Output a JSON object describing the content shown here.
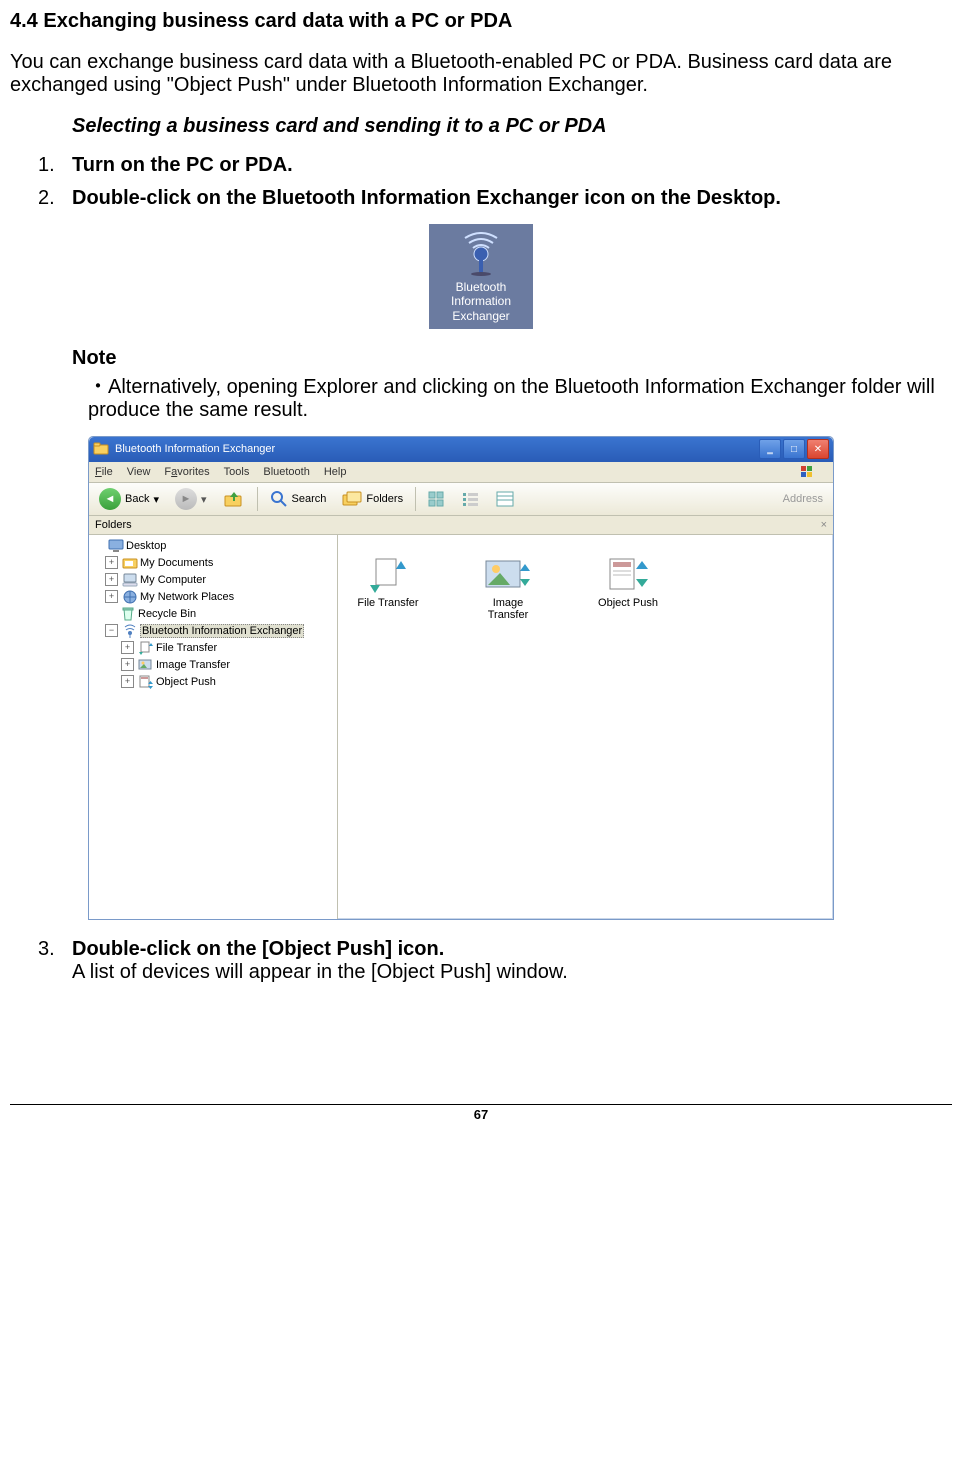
{
  "section_title": "4.4  Exchanging business card data with a PC or PDA",
  "intro": "You can exchange business card data with a Bluetooth-enabled PC or PDA. Business card data are exchanged using \"Object Push\" under Bluetooth Information Exchanger.",
  "sub_heading": "Selecting a business card and sending it to a PC or PDA",
  "steps": {
    "s1": {
      "num": "1.",
      "text": "Turn on the PC or PDA."
    },
    "s2": {
      "num": "2.",
      "text": "Double-click on the Bluetooth Information Exchanger icon on the Desktop."
    },
    "s3": {
      "num": "3.",
      "bold": "Double-click on the [Object Push] icon.",
      "plain": "A list of devices will appear in the [Object Push] window."
    }
  },
  "desktop_icon": {
    "line1": "Bluetooth",
    "line2": "Information",
    "line3": "Exchanger"
  },
  "note": {
    "head": "Note",
    "body": "・Alternatively, opening Explorer and clicking on the Bluetooth Information Exchanger folder will produce the same result."
  },
  "explorer": {
    "title": "Bluetooth Information Exchanger",
    "menu": {
      "file": "File",
      "view": "View",
      "fav": "Favorites",
      "tools": "Tools",
      "bt": "Bluetooth",
      "help": "Help"
    },
    "toolbar": {
      "back": "Back",
      "search": "Search",
      "folders": "Folders",
      "address": "Address"
    },
    "folders_label": "Folders",
    "tree": {
      "desktop": "Desktop",
      "mydocs": "My Documents",
      "mycomp": "My Computer",
      "mynet": "My Network Places",
      "recycle": "Recycle Bin",
      "bie": "Bluetooth Information Exchanger",
      "ft": "File Transfer",
      "it": "Image Transfer",
      "op": "Object Push"
    },
    "content": {
      "ft": "File Transfer",
      "it_l1": "Image",
      "it_l2": "Transfer",
      "op": "Object Push"
    }
  },
  "page_number": "67"
}
